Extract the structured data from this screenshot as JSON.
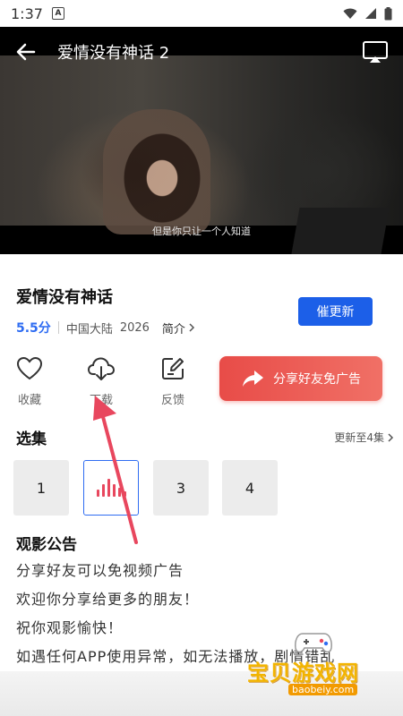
{
  "status_bar": {
    "time": "1:37",
    "badge": "A"
  },
  "video": {
    "title": "爱情没有神话 2",
    "subtitle": "但是你只让一个人知道"
  },
  "show": {
    "name": "爱情没有神话",
    "score": "5.5分",
    "region": "中国大陆",
    "year": "2026",
    "intro_label": "简介",
    "urge_button": "催更新"
  },
  "actions": {
    "favorite": "收藏",
    "download": "下载",
    "feedback": "反馈",
    "share_button": "分享好友免广告"
  },
  "episodes": {
    "title": "选集",
    "update_status": "更新至4集",
    "items": [
      "1",
      "",
      "3",
      "4"
    ]
  },
  "notice": {
    "title": "观影公告",
    "lines": [
      "分享好友可以免视频广告",
      "欢迎你分享给更多的朋友！",
      "祝你观影愉快！",
      "如遇任何APP使用异常，如无法播放，剧情错乱"
    ]
  },
  "watermark": {
    "main": "宝贝游戏网",
    "sub": "baobeiy.com"
  },
  "colors": {
    "accent": "#1c5fe8",
    "score": "#2e6cf2",
    "share": "#e84c48",
    "arrow": "#e8475e"
  }
}
